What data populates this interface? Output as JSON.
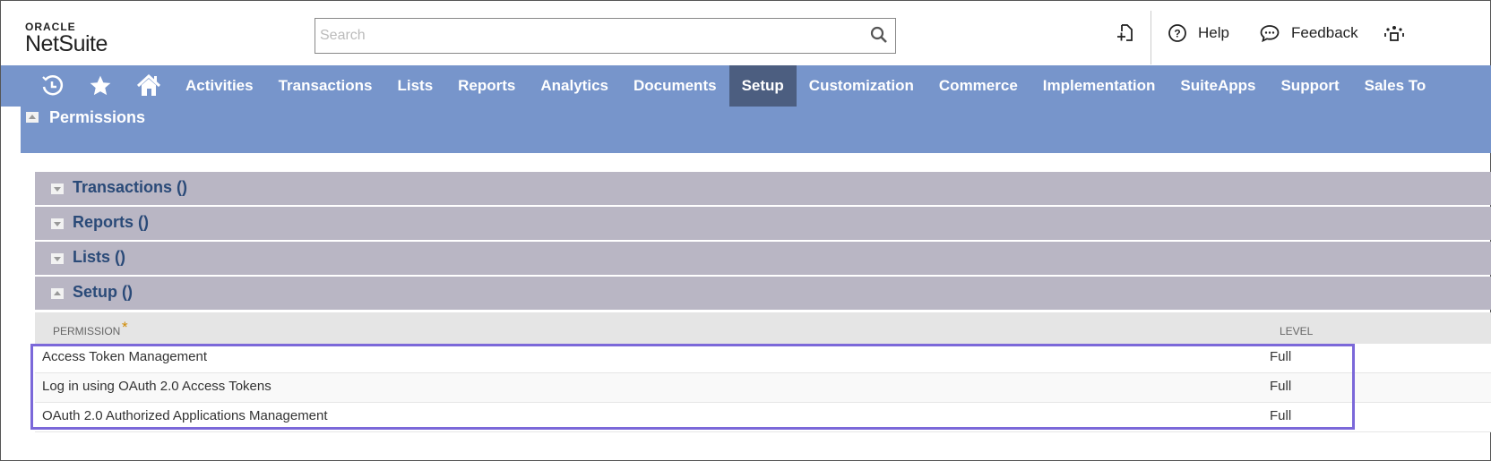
{
  "logo": {
    "top": "ORACLE",
    "bottom": "NetSuite"
  },
  "search": {
    "placeholder": "Search",
    "icon": "search-icon"
  },
  "header": {
    "help": "Help",
    "feedback": "Feedback"
  },
  "nav": {
    "items": [
      "Activities",
      "Transactions",
      "Lists",
      "Reports",
      "Analytics",
      "Documents",
      "Setup",
      "Customization",
      "Commerce",
      "Implementation",
      "SuiteApps",
      "Support",
      "Sales To"
    ],
    "active": "Setup"
  },
  "permissions": {
    "title": "Permissions",
    "sections": [
      {
        "label": "Transactions ()",
        "expanded": false
      },
      {
        "label": "Reports ()",
        "expanded": false
      },
      {
        "label": "Lists ()",
        "expanded": false
      },
      {
        "label": "Setup ()",
        "expanded": true
      }
    ],
    "columns": {
      "permission": "PERMISSION",
      "required": "*",
      "level": "LEVEL"
    },
    "rows": [
      {
        "permission": "Access Token Management",
        "level": "Full"
      },
      {
        "permission": "Log in using OAuth 2.0 Access Tokens",
        "level": "Full"
      },
      {
        "permission": "OAuth 2.0 Authorized Applications Management",
        "level": "Full"
      }
    ]
  },
  "colors": {
    "nav": "#7795cb",
    "nav_active": "#4c5e80",
    "section": "#b9b6c4",
    "highlight": "#7b68d9",
    "required": "#d08a00"
  }
}
